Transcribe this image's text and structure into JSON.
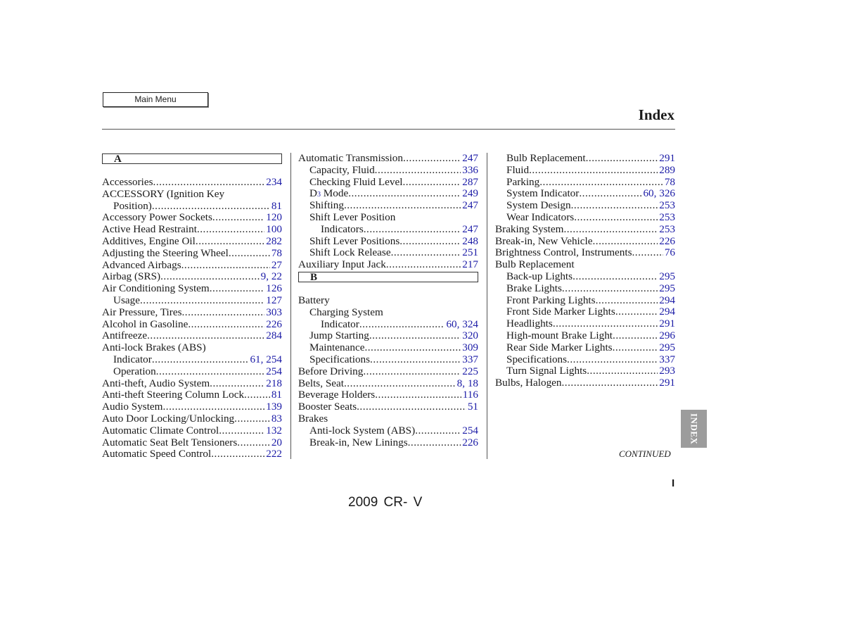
{
  "header": {
    "main_menu_label": "Main Menu",
    "title": "Index"
  },
  "columns": [
    {
      "rows": [
        {
          "type": "letter",
          "text": "A"
        },
        {
          "type": "entry",
          "level": 0,
          "label": "Accessories",
          "page": "234"
        },
        {
          "type": "entry",
          "level": 0,
          "label": "ACCESSORY (Ignition Key",
          "page": ""
        },
        {
          "type": "entry",
          "level": 1,
          "label": "Position)",
          "page": "81"
        },
        {
          "type": "entry",
          "level": 0,
          "label": "Accessory Power Sockets",
          "page": "120"
        },
        {
          "type": "entry",
          "level": 0,
          "label": "Active Head Restraint",
          "page": "100"
        },
        {
          "type": "entry",
          "level": 0,
          "label": "Additives, Engine Oil",
          "page": "282"
        },
        {
          "type": "entry",
          "level": 0,
          "label": "Adjusting the Steering Wheel",
          "page": "78"
        },
        {
          "type": "entry",
          "level": 0,
          "label": "Advanced Airbags",
          "page": "27"
        },
        {
          "type": "entry",
          "level": 0,
          "label": "Airbag (SRS)",
          "page": "9, 22"
        },
        {
          "type": "entry",
          "level": 0,
          "label": "Air Conditioning System",
          "page": "126"
        },
        {
          "type": "entry",
          "level": 1,
          "label": "Usage",
          "page": "127"
        },
        {
          "type": "entry",
          "level": 0,
          "label": "Air Pressure, Tires",
          "page": "303"
        },
        {
          "type": "entry",
          "level": 0,
          "label": "Alcohol in Gasoline",
          "page": "226"
        },
        {
          "type": "entry",
          "level": 0,
          "label": "Antifreeze",
          "page": "284"
        },
        {
          "type": "entry",
          "level": 0,
          "label": "Anti-lock Brakes (ABS)",
          "page": ""
        },
        {
          "type": "entry",
          "level": 1,
          "label": "Indicator",
          "page": "61, 254"
        },
        {
          "type": "entry",
          "level": 1,
          "label": "Operation",
          "page": "254"
        },
        {
          "type": "entry",
          "level": 0,
          "label": "Anti-theft, Audio System",
          "page": "218"
        },
        {
          "type": "entry",
          "level": 0,
          "label": "Anti-theft Steering Column Lock",
          "page": "81"
        },
        {
          "type": "entry",
          "level": 0,
          "label": "Audio System",
          "page": "139"
        },
        {
          "type": "entry",
          "level": 0,
          "label": "Auto Door Locking/Unlocking",
          "page": "83"
        },
        {
          "type": "entry",
          "level": 0,
          "label": "Automatic Climate Control",
          "page": "132"
        },
        {
          "type": "entry",
          "level": 0,
          "label": "Automatic Seat Belt Tensioners",
          "page": "20"
        },
        {
          "type": "entry",
          "level": 0,
          "label": "Automatic Speed Control",
          "page": "222"
        }
      ]
    },
    {
      "rows": [
        {
          "type": "entry",
          "level": 0,
          "label": "Automatic Transmission",
          "page": "247"
        },
        {
          "type": "entry",
          "level": 1,
          "label": "Capacity, Fluid",
          "page": "336"
        },
        {
          "type": "entry",
          "level": 1,
          "label": "Checking Fluid Level",
          "page": "287"
        },
        {
          "type": "entry",
          "level": 1,
          "label": "D",
          "sub": "3",
          "label_rest": " Mode",
          "page": "249"
        },
        {
          "type": "entry",
          "level": 1,
          "label": "Shifting",
          "page": "247"
        },
        {
          "type": "entry",
          "level": 1,
          "label": "Shift Lever Position",
          "page": ""
        },
        {
          "type": "entry",
          "level": 2,
          "label": "Indicators",
          "page": "247"
        },
        {
          "type": "entry",
          "level": 1,
          "label": "Shift Lever Positions",
          "page": "248"
        },
        {
          "type": "entry",
          "level": 1,
          "label": "Shift Lock Release",
          "page": "251"
        },
        {
          "type": "entry",
          "level": 0,
          "label": "Auxiliary Input Jack",
          "page": "217"
        },
        {
          "type": "letter",
          "text": "B"
        },
        {
          "type": "entry",
          "level": 0,
          "label": "Battery",
          "page": ""
        },
        {
          "type": "entry",
          "level": 1,
          "label": "Charging System",
          "page": ""
        },
        {
          "type": "entry",
          "level": 2,
          "label": "Indicator",
          "page": "60, 324"
        },
        {
          "type": "entry",
          "level": 1,
          "label": "Jump Starting",
          "page": "320"
        },
        {
          "type": "entry",
          "level": 1,
          "label": "Maintenance",
          "page": "309"
        },
        {
          "type": "entry",
          "level": 1,
          "label": "Specifications",
          "page": "337"
        },
        {
          "type": "entry",
          "level": 0,
          "label": "Before Driving",
          "page": "225"
        },
        {
          "type": "entry",
          "level": 0,
          "label": "Belts, Seat",
          "page": "8, 18"
        },
        {
          "type": "entry",
          "level": 0,
          "label": "Beverage Holders",
          "page": "116"
        },
        {
          "type": "entry",
          "level": 0,
          "label": "Booster Seats",
          "page": "51"
        },
        {
          "type": "entry",
          "level": 0,
          "label": "Brakes",
          "page": ""
        },
        {
          "type": "entry",
          "level": 1,
          "label": "Anti-lock System (ABS)",
          "page": "254"
        },
        {
          "type": "entry",
          "level": 1,
          "label": "Break-in, New Linings",
          "page": "226"
        }
      ]
    },
    {
      "rows": [
        {
          "type": "entry",
          "level": 1,
          "label": "Bulb Replacement",
          "page": "291"
        },
        {
          "type": "entry",
          "level": 1,
          "label": "Fluid",
          "page": "289"
        },
        {
          "type": "entry",
          "level": 1,
          "label": "Parking",
          "page": "78"
        },
        {
          "type": "entry",
          "level": 1,
          "label": "System Indicator",
          "page": "60, 326"
        },
        {
          "type": "entry",
          "level": 1,
          "label": "System Design",
          "page": "253"
        },
        {
          "type": "entry",
          "level": 1,
          "label": "Wear Indicators",
          "page": "253"
        },
        {
          "type": "entry",
          "level": 0,
          "label": "Braking System",
          "page": "253"
        },
        {
          "type": "entry",
          "level": 0,
          "label": "Break-in, New Vehicle",
          "page": "226"
        },
        {
          "type": "entry",
          "level": 0,
          "label": "Brightness Control, Instruments",
          "page": "76"
        },
        {
          "type": "entry",
          "level": 0,
          "label": "Bulb Replacement",
          "page": ""
        },
        {
          "type": "entry",
          "level": 1,
          "label": "Back-up Lights",
          "page": "295"
        },
        {
          "type": "entry",
          "level": 1,
          "label": "Brake Lights",
          "page": "295"
        },
        {
          "type": "entry",
          "level": 1,
          "label": "Front Parking Lights",
          "page": "294"
        },
        {
          "type": "entry",
          "level": 1,
          "label": "Front Side Marker Lights",
          "page": "294"
        },
        {
          "type": "entry",
          "level": 1,
          "label": "Headlights",
          "page": "291"
        },
        {
          "type": "entry",
          "level": 1,
          "label": "High-mount Brake Light",
          "page": "296"
        },
        {
          "type": "entry",
          "level": 1,
          "label": "Rear Side Marker Lights",
          "page": "295"
        },
        {
          "type": "entry",
          "level": 1,
          "label": "Specifications",
          "page": "337"
        },
        {
          "type": "entry",
          "level": 1,
          "label": "Turn Signal Lights",
          "page": "293"
        },
        {
          "type": "entry",
          "level": 0,
          "label": "Bulbs, Halogen",
          "page": "291"
        }
      ]
    }
  ],
  "continued_label": "CONTINUED",
  "side_tab_label": "INDEX",
  "page_number": "I",
  "footer": "2009  CR- V",
  "colors": {
    "page_link": "#1a1aa6",
    "side_tab": "#9c9c9c"
  }
}
